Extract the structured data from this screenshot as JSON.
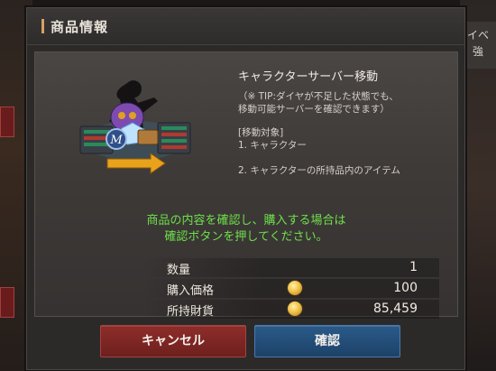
{
  "dialog": {
    "title": "商品情報"
  },
  "item": {
    "icon": "server-transfer-icon",
    "title": "キャラクターサーバー移動",
    "description": [
      "（※ TIP:ダイヤが不足した状態でも、",
      "移動可能サーバーを確認できます）",
      "[移動対象]",
      "1. キャラクター",
      "2. キャラクターの所持品内のアイテム"
    ]
  },
  "notice": {
    "line1": "商品の内容を確認し、購入する場合は",
    "line2": "確認ボタンを押してください。"
  },
  "stats": {
    "quantity": {
      "label": "数量",
      "value": "1"
    },
    "price": {
      "label": "購入価格",
      "value": "100",
      "icon": "gold-coin-icon"
    },
    "balance": {
      "label": "所持財貨",
      "value": "85,459",
      "icon": "gold-coin-icon"
    }
  },
  "buttons": {
    "cancel": "キャンセル",
    "confirm": "確認"
  },
  "background": {
    "right_tab": "イベ\n強"
  },
  "colors": {
    "notice": "#6ee04a",
    "cancel": "#8e2d2a",
    "confirm": "#2a5a8a",
    "accent": "#d7a060"
  }
}
